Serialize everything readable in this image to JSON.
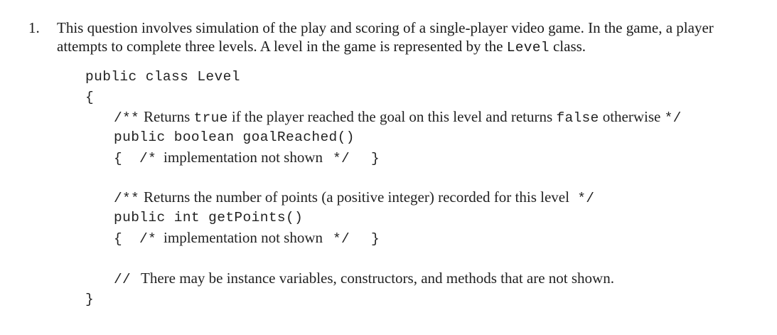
{
  "question": {
    "number": "1.",
    "intro_line1": "This question involves simulation of the play and scoring of a single-player video game. In the game, a player",
    "intro_line2_pre": "attempts to complete three levels. A level in the game is represented by the ",
    "intro_line2_code": "Level",
    "intro_line2_post": " class."
  },
  "code": {
    "class_decl": "public class Level",
    "open_brace": "{",
    "close_brace": "}",
    "method1": {
      "comment_open": "/**",
      "comment_text_a": "Returns ",
      "comment_code_true": "true",
      "comment_text_b": " if the player reached the goal on this level and returns ",
      "comment_code_false": "false",
      "comment_text_c": " otherwise ",
      "comment_close": "*/",
      "signature": "public boolean goalReached()",
      "body_open": "{",
      "body_comment_open": "/*",
      "body_comment_text": "implementation not shown",
      "body_comment_close": "*/",
      "body_close": "}"
    },
    "method2": {
      "comment_open": "/**",
      "comment_text": "Returns the number of points (a positive integer) recorded for this level ",
      "comment_close": "*/",
      "signature": "public int getPoints()",
      "body_open": "{",
      "body_comment_open": "/*",
      "body_comment_text": "implementation not shown",
      "body_comment_close": "*/",
      "body_close": "}"
    },
    "trailing_comment_marker": "//",
    "trailing_comment_text": "There may be instance variables, constructors, and methods that are not shown."
  }
}
